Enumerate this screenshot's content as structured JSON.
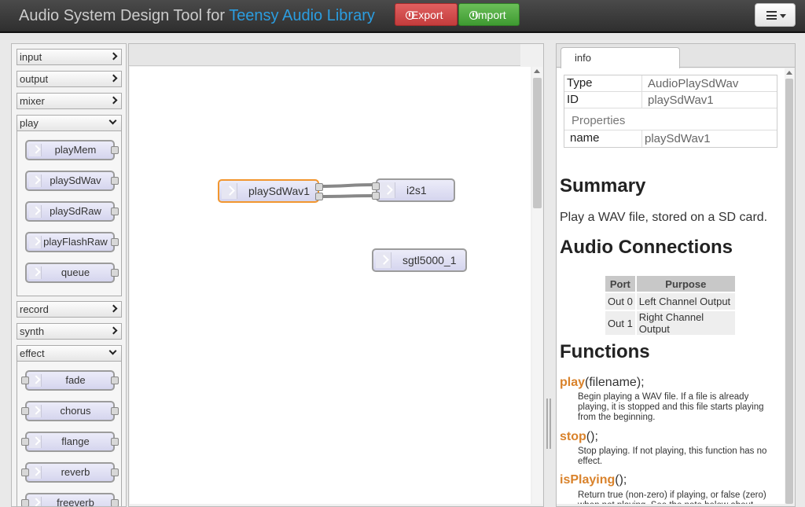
{
  "header": {
    "title_prefix": "Audio System Design Tool for ",
    "title_accent": "Teensy Audio Library",
    "export_label": "Export",
    "import_label": "Import"
  },
  "palette": {
    "categories": [
      {
        "label": "input",
        "open": false
      },
      {
        "label": "output",
        "open": false
      },
      {
        "label": "mixer",
        "open": false
      },
      {
        "label": "play",
        "open": true,
        "nodes": [
          "playMem",
          "playSdWav",
          "playSdRaw",
          "playFlashRaw",
          "queue"
        ]
      },
      {
        "label": "record",
        "open": false
      },
      {
        "label": "synth",
        "open": false
      },
      {
        "label": "effect",
        "open": true,
        "nodes": [
          "fade",
          "chorus",
          "flange",
          "reverb",
          "freeverb"
        ]
      }
    ]
  },
  "canvas": {
    "nodes": [
      "playSdWav1",
      "i2s1",
      "sgtl5000_1"
    ],
    "selected": "playSdWav1",
    "selected_color": "#f2962f"
  },
  "info": {
    "tab_label": "info",
    "props": {
      "type_key": "Type",
      "type_val": "AudioPlaySdWav",
      "id_key": "ID",
      "id_val": "playSdWav1",
      "properties_label": "Properties",
      "name_key": "name",
      "name_val": "playSdWav1"
    },
    "summary_heading": "Summary",
    "summary_text": "Play a WAV file, stored on a SD card.",
    "connections_heading": "Audio Connections",
    "conn_headers": [
      "Port",
      "Purpose"
    ],
    "connections": [
      {
        "port": "Out 0",
        "purpose": "Left Channel Output"
      },
      {
        "port": "Out 1",
        "purpose": "Right Channel Output"
      }
    ],
    "functions_heading": "Functions",
    "functions": [
      {
        "name": "play",
        "args": "(filename);",
        "desc": "Begin playing a WAV file. If a file is already playing, it is stopped and this file starts playing from the beginning."
      },
      {
        "name": "stop",
        "args": "();",
        "desc": "Stop playing. If not playing, this function has no effect."
      },
      {
        "name": "isPlaying",
        "args": "();",
        "desc": "Return true (non-zero) if playing, or false (zero) when not playing. See the note below about"
      }
    ]
  }
}
